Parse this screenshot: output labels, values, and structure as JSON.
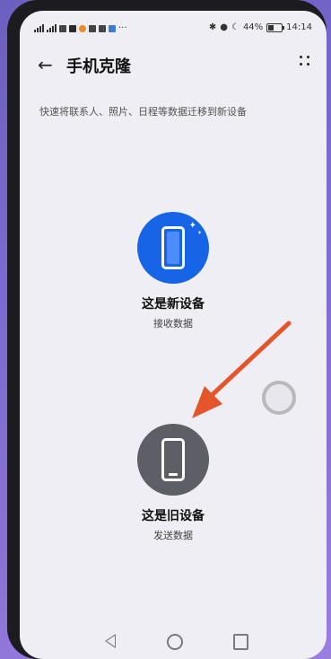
{
  "status_bar": {
    "battery_text": "44%",
    "time": "14:14",
    "left_icons": [
      "signal-icon",
      "signal-icon",
      "nfc-icon",
      "video-icon",
      "app-icon",
      "call-icon",
      "sim-icon",
      "app-icon",
      "more-icon"
    ],
    "right_icons": [
      "bluetooth-icon",
      "mic-icon",
      "moon-icon",
      "battery-icon"
    ]
  },
  "header": {
    "title": "手机克隆"
  },
  "description": "快速将联系人、照片、日程等数据迁移到新设备",
  "options": {
    "new": {
      "title": "这是新设备",
      "subtitle": "接收数据",
      "icon": "phone-sparkle-icon",
      "color": "#1565e6"
    },
    "old": {
      "title": "这是旧设备",
      "subtitle": "发送数据",
      "icon": "phone-icon",
      "color": "#5e5e66"
    }
  },
  "accent_arrow_color": "#e4552a"
}
